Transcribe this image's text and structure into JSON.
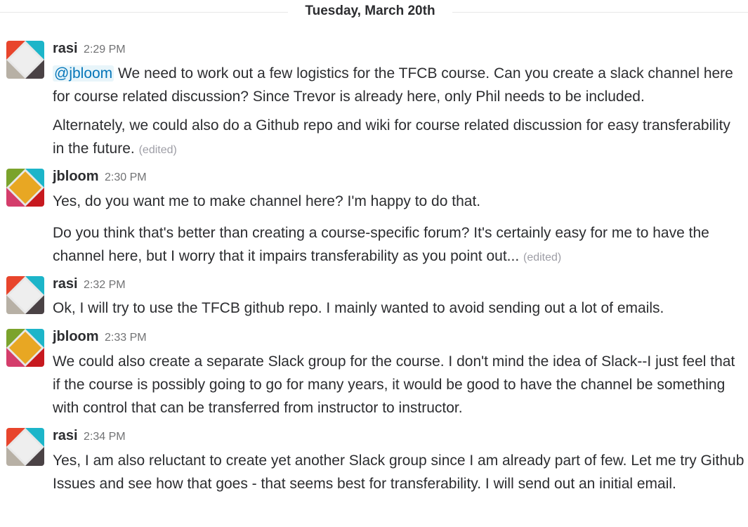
{
  "day_divider": {
    "label": "Tuesday, March 20th"
  },
  "messages": [
    {
      "author": "rasi",
      "time": "2:29 PM",
      "paragraphs": [
        {
          "mention": "@jbloom",
          "text": " We need to work out a few logistics for the TFCB course. Can you create a slack channel here for course related discussion? Since Trevor is already here, only Phil needs to be included."
        },
        {
          "text": "Alternately, we could also do a Github repo and wiki for course related discussion for easy transferability in the future.",
          "edited": "(edited)"
        }
      ]
    },
    {
      "author": "jbloom",
      "time": "2:30 PM",
      "paragraphs": [
        {
          "text": "Yes, do you want me to make channel here? I'm happy to do that."
        },
        {
          "text": "Do you think that's better than creating a course-specific forum? It's certainly easy for me to have the channel here, but I worry that it impairs transferability as you point out...",
          "edited": "(edited)"
        }
      ]
    },
    {
      "author": "rasi",
      "time": "2:32 PM",
      "paragraphs": [
        {
          "text": "Ok, I will try to use the TFCB github repo. I mainly wanted to avoid sending out a lot of emails."
        }
      ]
    },
    {
      "author": "jbloom",
      "time": "2:33 PM",
      "paragraphs": [
        {
          "text": "We could also create a separate Slack group for the course. I don't mind the idea of Slack--I just feel that if the course is possibly going to go for many years, it would be good to have the channel be something with control that can be transferred from instructor to instructor."
        }
      ]
    },
    {
      "author": "rasi",
      "time": "2:34 PM",
      "paragraphs": [
        {
          "text": "Yes, I am also reluctant to create yet another Slack group since I am already part of few. Let me try Github Issues and see how that goes - that seems best for transferability. I will send out an initial email."
        }
      ]
    }
  ],
  "avatars": {
    "rasi": {
      "icon": "identicon-avatar-icon",
      "colors": [
        "#e8452c",
        "#1cb5c9",
        "#b7b0a5",
        "#4a4245",
        "#e7e7e7"
      ]
    },
    "jbloom": {
      "icon": "identicon-avatar-icon",
      "colors": [
        "#7ba32c",
        "#e8a723",
        "#1cb5c9",
        "#d43d6b",
        "#c7191f",
        "#e7e7e7"
      ]
    }
  }
}
